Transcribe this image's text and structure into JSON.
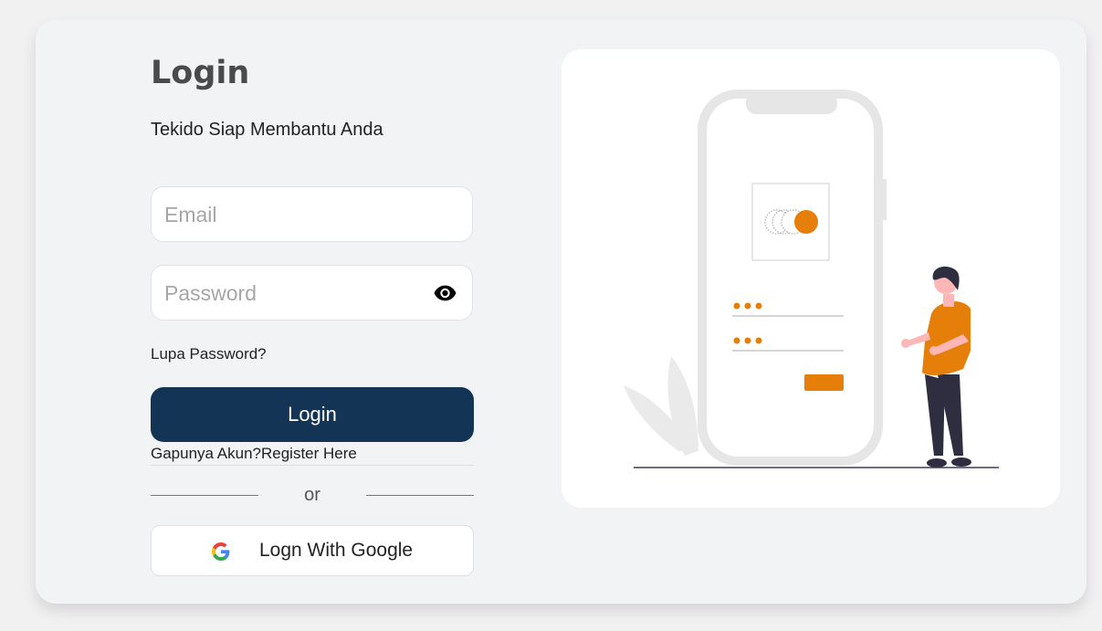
{
  "login": {
    "title": "Login",
    "subtitle": "Tekido Siap Membantu Anda",
    "email_placeholder": "Email",
    "password_placeholder": "Password",
    "forgot_label": "Lupa Password?",
    "submit_label": "Login",
    "register_prompt": "Gapunya Akun?",
    "register_link": "Register Here",
    "divider_label": "or",
    "google_label": "Logn With Google"
  },
  "colors": {
    "primary": "#133455",
    "accent": "#e57f0a",
    "background": "#f2f3f5"
  },
  "icons": {
    "password_toggle": "eye-icon",
    "google": "google-logo-icon"
  }
}
